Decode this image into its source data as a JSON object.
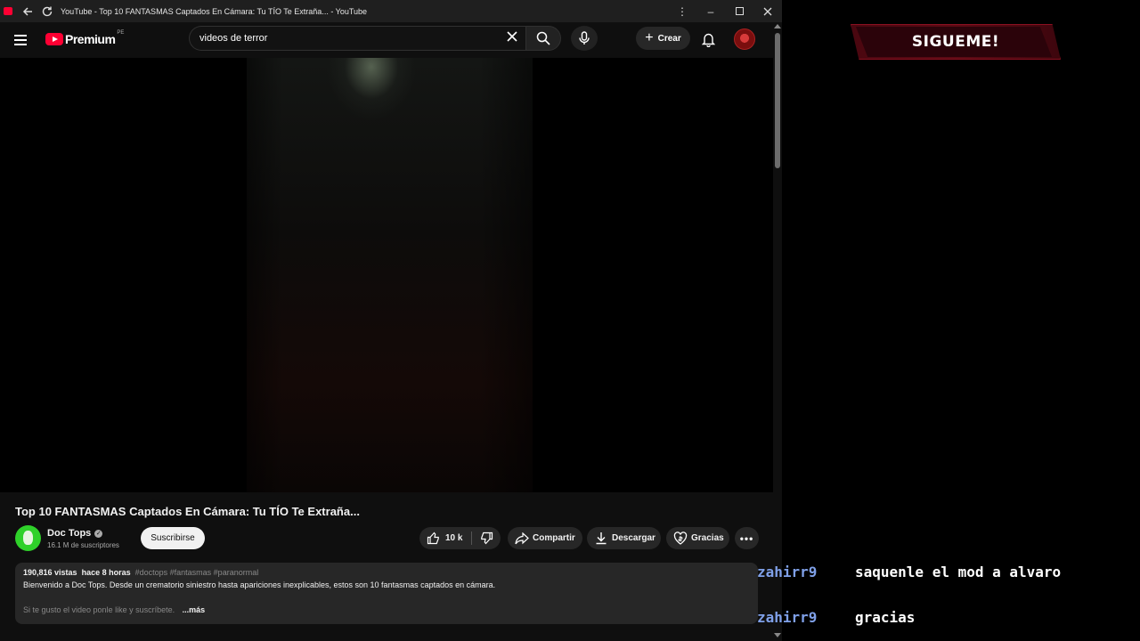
{
  "window": {
    "title": "YouTube - Top 10 FANTASMAS Captados En Cámara: Tu TÍO Te Extraña... - YouTube"
  },
  "header": {
    "logo_text": "Premium",
    "logo_country": "PE",
    "search_value": "videos de terror",
    "create_label": "Crear"
  },
  "video": {
    "title": "Top 10 FANTASMAS Captados En Cámara: Tu TÍO Te Extraña...",
    "channel_name": "Doc Tops",
    "subscribers": "16.1 M de suscriptores",
    "subscribe_label": "Suscribirse",
    "likes": "10 k",
    "share_label": "Compartir",
    "download_label": "Descargar",
    "thanks_label": "Gracias"
  },
  "description": {
    "views": "190,816 vistas",
    "age": "hace 8 horas",
    "tags": "#doctops #fantasmas #paranormal",
    "line1": "Bienvenido a Doc Tops.  Desde un crematorio siniestro hasta apariciones inexplicables, estos son 10 fantasmas captados en cámara.",
    "line2": "Si te gusto el video ponle like y suscríbete.",
    "more_label": "...más"
  },
  "overlay": {
    "follow_text": "SIGUEME!",
    "chat": [
      {
        "user": "zahirr9",
        "text": "saquenle el mod a alvaro"
      },
      {
        "user": "zahirr9",
        "text": "gracias"
      }
    ],
    "colors": {
      "banner": "#5c0a14",
      "chat_user": "#7fa0e8"
    }
  },
  "icons": [
    "back-arrow-icon",
    "reload-icon",
    "kebab-menu-icon",
    "menu-icon",
    "clear-icon",
    "search-icon",
    "mic-icon",
    "plus-icon",
    "bell-icon",
    "verified-icon",
    "like-icon",
    "dislike-icon",
    "share-icon",
    "download-icon",
    "thanks-icon",
    "more-icon"
  ]
}
